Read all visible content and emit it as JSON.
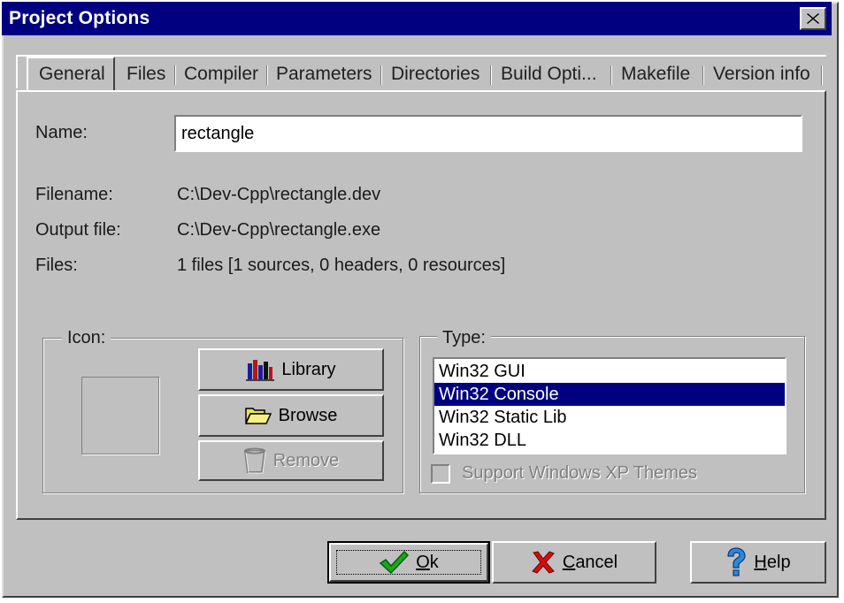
{
  "window": {
    "title": "Project Options"
  },
  "tabs": [
    {
      "label": "General",
      "active": true
    },
    {
      "label": "Files",
      "active": false
    },
    {
      "label": "Compiler",
      "active": false
    },
    {
      "label": "Parameters",
      "active": false
    },
    {
      "label": "Directories",
      "active": false
    },
    {
      "label": "Build Opti...",
      "active": false
    },
    {
      "label": "Makefile",
      "active": false
    },
    {
      "label": "Version info",
      "active": false
    }
  ],
  "general": {
    "name_label": "Name:",
    "name_value": "rectangle",
    "filename_label": "Filename:",
    "filename_value": "C:\\Dev-Cpp\\rectangle.dev",
    "output_label": "Output file:",
    "output_value": "C:\\Dev-Cpp\\rectangle.exe",
    "files_label": "Files:",
    "files_value": "1 files [1 sources, 0 headers, 0 resources]"
  },
  "icon_group": {
    "title": "Icon:",
    "library_label": "Library",
    "browse_label": "Browse",
    "remove_label": "Remove"
  },
  "type_group": {
    "title": "Type:",
    "options": [
      "Win32 GUI",
      "Win32 Console",
      "Win32 Static Lib",
      "Win32 DLL"
    ],
    "selected": "Win32 Console",
    "xp_themes_label": "Support Windows XP Themes",
    "xp_themes_checked": false
  },
  "buttons": {
    "ok": "Ok",
    "cancel": "Cancel",
    "help": "Help"
  },
  "colors": {
    "title_bar": "#000080",
    "face": "#c0c0c0",
    "selection": "#000080"
  },
  "icons": {
    "close": "close-icon",
    "library": "library-books-icon",
    "browse": "folder-open-icon",
    "remove": "trash-can-icon",
    "ok": "green-checkmark-icon",
    "cancel": "red-x-icon",
    "help": "question-mark-icon"
  }
}
